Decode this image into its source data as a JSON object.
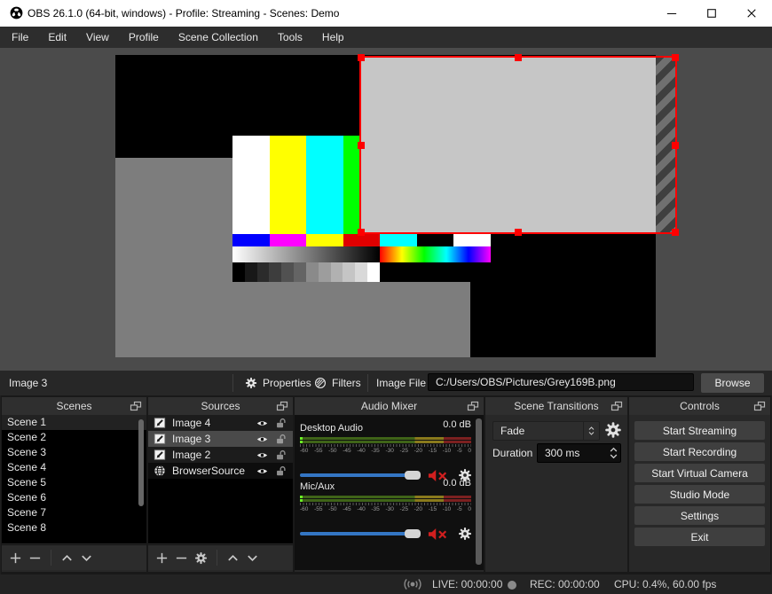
{
  "window": {
    "title": "OBS 26.1.0 (64-bit, windows) - Profile: Streaming - Scenes: Demo"
  },
  "menu": {
    "items": [
      "File",
      "Edit",
      "View",
      "Profile",
      "Scene Collection",
      "Tools",
      "Help"
    ]
  },
  "source_toolbar": {
    "selected_source": "Image 3",
    "properties": "Properties",
    "filters": "Filters",
    "image_file_label": "Image File",
    "image_file_value": "C:/Users/OBS/Pictures/Grey169B.png",
    "browse": "Browse"
  },
  "scenes": {
    "title": "Scenes",
    "items": [
      "Scene 1",
      "Scene 2",
      "Scene 3",
      "Scene 4",
      "Scene 5",
      "Scene 6",
      "Scene 7",
      "Scene 8"
    ],
    "selected": "Scene 1"
  },
  "sources": {
    "title": "Sources",
    "items": [
      {
        "name": "Image 4",
        "icon": "image-icon",
        "visible": true,
        "locked": false
      },
      {
        "name": "Image 3",
        "icon": "image-icon",
        "visible": true,
        "locked": false,
        "selected": true
      },
      {
        "name": "Image 2",
        "icon": "image-icon",
        "visible": true,
        "locked": false
      },
      {
        "name": "BrowserSource",
        "icon": "globe-icon",
        "visible": true,
        "locked": false
      }
    ]
  },
  "audio_mixer": {
    "title": "Audio Mixer",
    "channels": [
      {
        "name": "Desktop Audio",
        "level": "0.0 dB"
      },
      {
        "name": "Mic/Aux",
        "level": "0.0 dB"
      }
    ],
    "scale": [
      "-60",
      "-55",
      "-50",
      "-45",
      "-40",
      "-35",
      "-30",
      "-25",
      "-20",
      "-15",
      "-10",
      "-5",
      "0"
    ]
  },
  "transitions": {
    "title": "Scene Transitions",
    "selected": "Fade",
    "duration_label": "Duration",
    "duration_value": "300 ms"
  },
  "controls": {
    "title": "Controls",
    "buttons": [
      "Start Streaming",
      "Start Recording",
      "Start Virtual Camera",
      "Studio Mode",
      "Settings",
      "Exit"
    ]
  },
  "status": {
    "live": "LIVE: 00:00:00",
    "rec": "REC: 00:00:00",
    "stats": "CPU: 0.4%, 60.00 fps"
  },
  "colors": {
    "selection_red": "#ff0000",
    "slider_blue": "#3476c4",
    "meter_green_dim": "#3f6418",
    "meter_yellow_dim": "#8a7a1c",
    "meter_red_dim": "#7c2020",
    "meter_green_bright": "#6bef25"
  }
}
